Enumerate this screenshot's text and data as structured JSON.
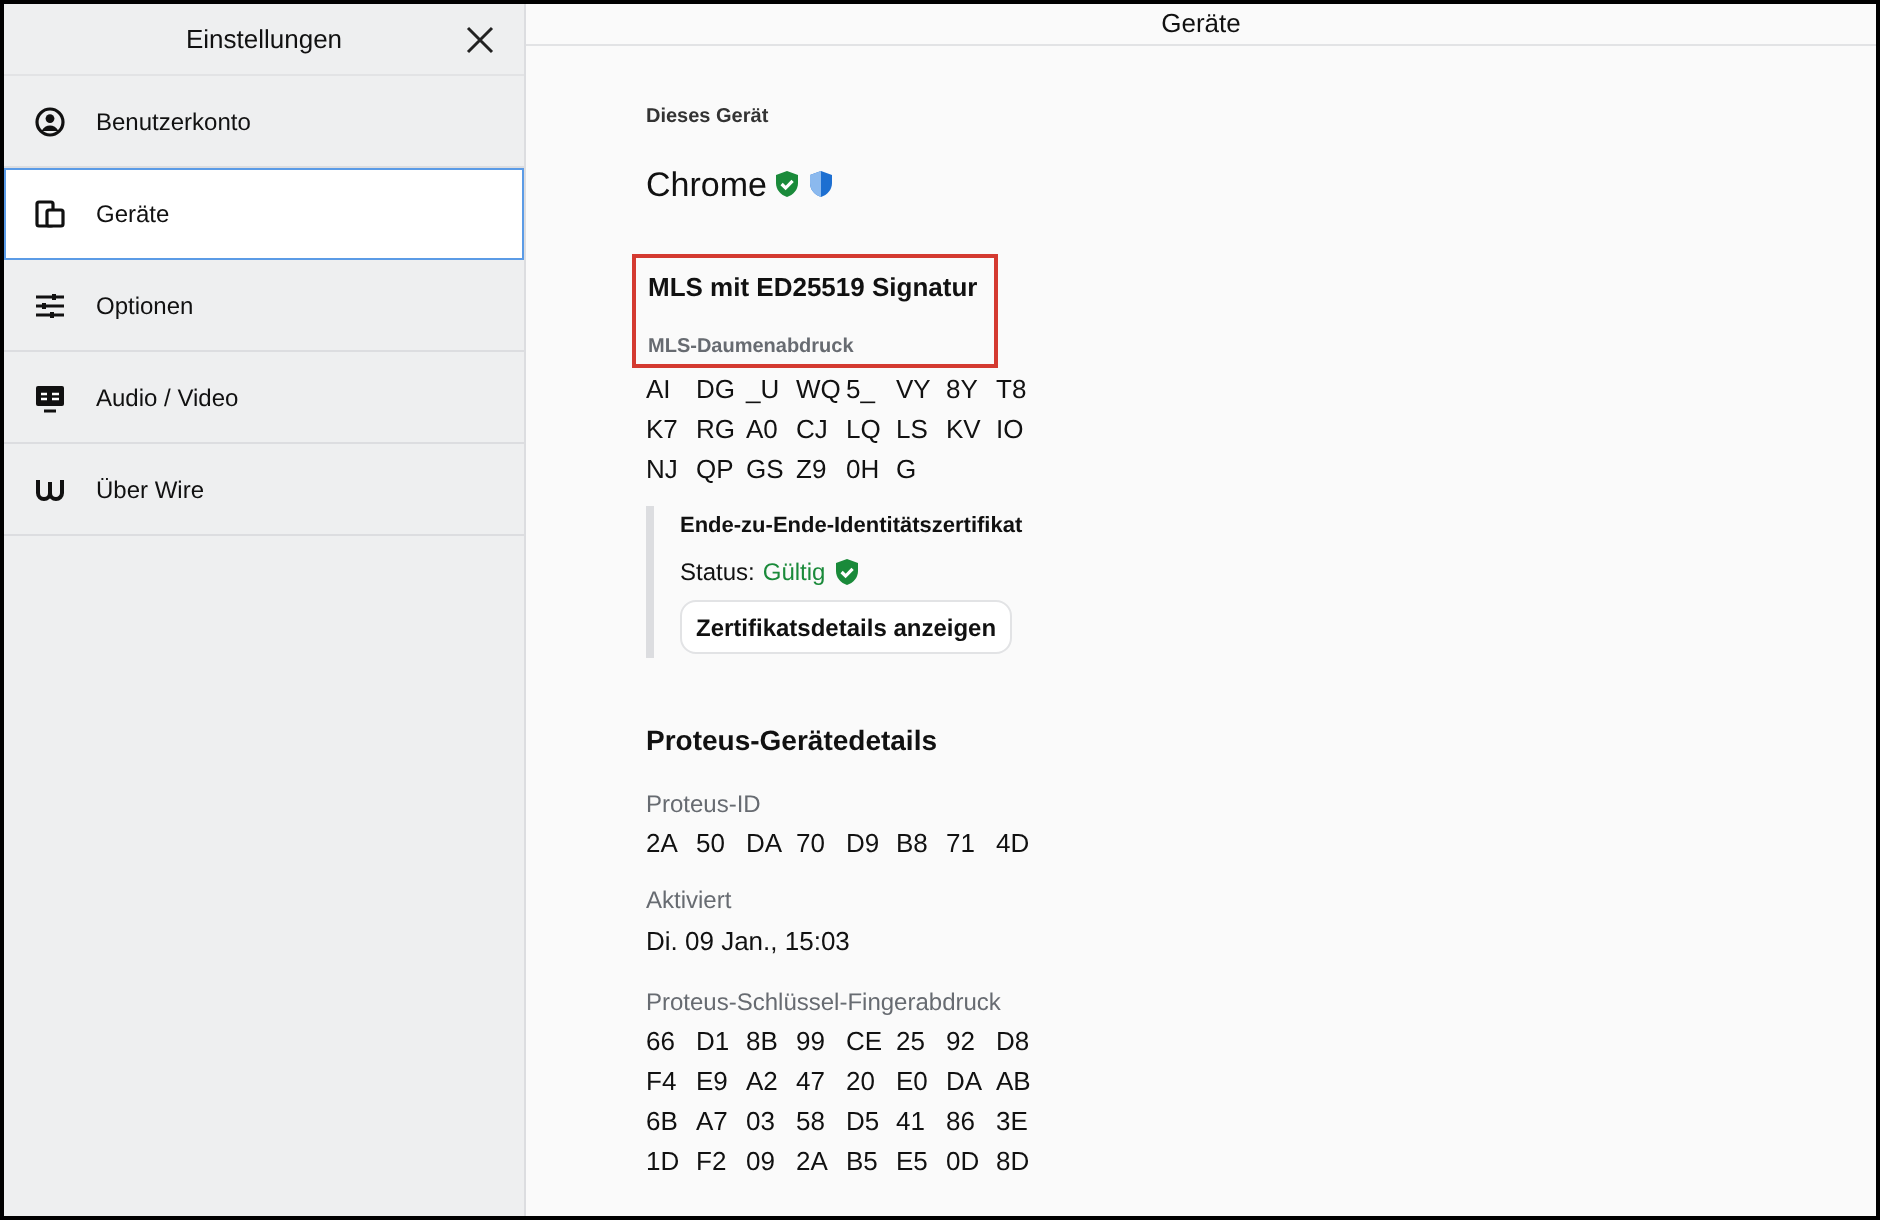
{
  "sidebar": {
    "title": "Einstellungen",
    "items": [
      {
        "label": "Benutzerkonto",
        "selected": false
      },
      {
        "label": "Geräte",
        "selected": true
      },
      {
        "label": "Optionen",
        "selected": false
      },
      {
        "label": "Audio / Video",
        "selected": false
      },
      {
        "label": "Über Wire",
        "selected": false
      }
    ]
  },
  "main": {
    "title": "Geräte",
    "device_label": "Dieses Gerät",
    "device_name": "Chrome",
    "verified": true,
    "proteus_verified": true,
    "mls": {
      "title": "MLS mit ED25519 Signatur",
      "highlighted": true,
      "fingerprint_label": "MLS-Daumenabdruck",
      "fingerprint_rows": [
        [
          "AI",
          "DG",
          "_U",
          "WQ",
          "5_",
          "VY",
          "8Y",
          "T8"
        ],
        [
          "K7",
          "RG",
          "A0",
          "CJ",
          "LQ",
          "LS",
          "KV",
          "IO"
        ],
        [
          "NJ",
          "QP",
          "GS",
          "Z9",
          "0H",
          "G"
        ]
      ]
    },
    "certificate": {
      "title": "Ende-zu-Ende-Identitätszertifikat",
      "status_label": "Status:",
      "status": "Gültig",
      "valid": true,
      "button": "Zertifikatsdetails anzeigen"
    },
    "proteus": {
      "title": "Proteus-Gerätedetails",
      "id_label": "Proteus-ID",
      "id_rows": [
        [
          "2A",
          "50",
          "DA",
          "70",
          "D9",
          "B8",
          "71",
          "4D"
        ]
      ],
      "activated_label": "Aktiviert",
      "activated": "Di. 09 Jan., 15:03",
      "fingerprint_label": "Proteus-Schlüssel-Fingerabdruck",
      "fingerprint_rows": [
        [
          "66",
          "D1",
          "8B",
          "99",
          "CE",
          "25",
          "92",
          "D8"
        ],
        [
          "F4",
          "E9",
          "A2",
          "47",
          "20",
          "E0",
          "DA",
          "AB"
        ],
        [
          "6B",
          "A7",
          "03",
          "58",
          "D5",
          "41",
          "86",
          "3E"
        ],
        [
          "1D",
          "F2",
          "09",
          "2A",
          "B5",
          "E5",
          "0D",
          "8D"
        ]
      ]
    }
  }
}
